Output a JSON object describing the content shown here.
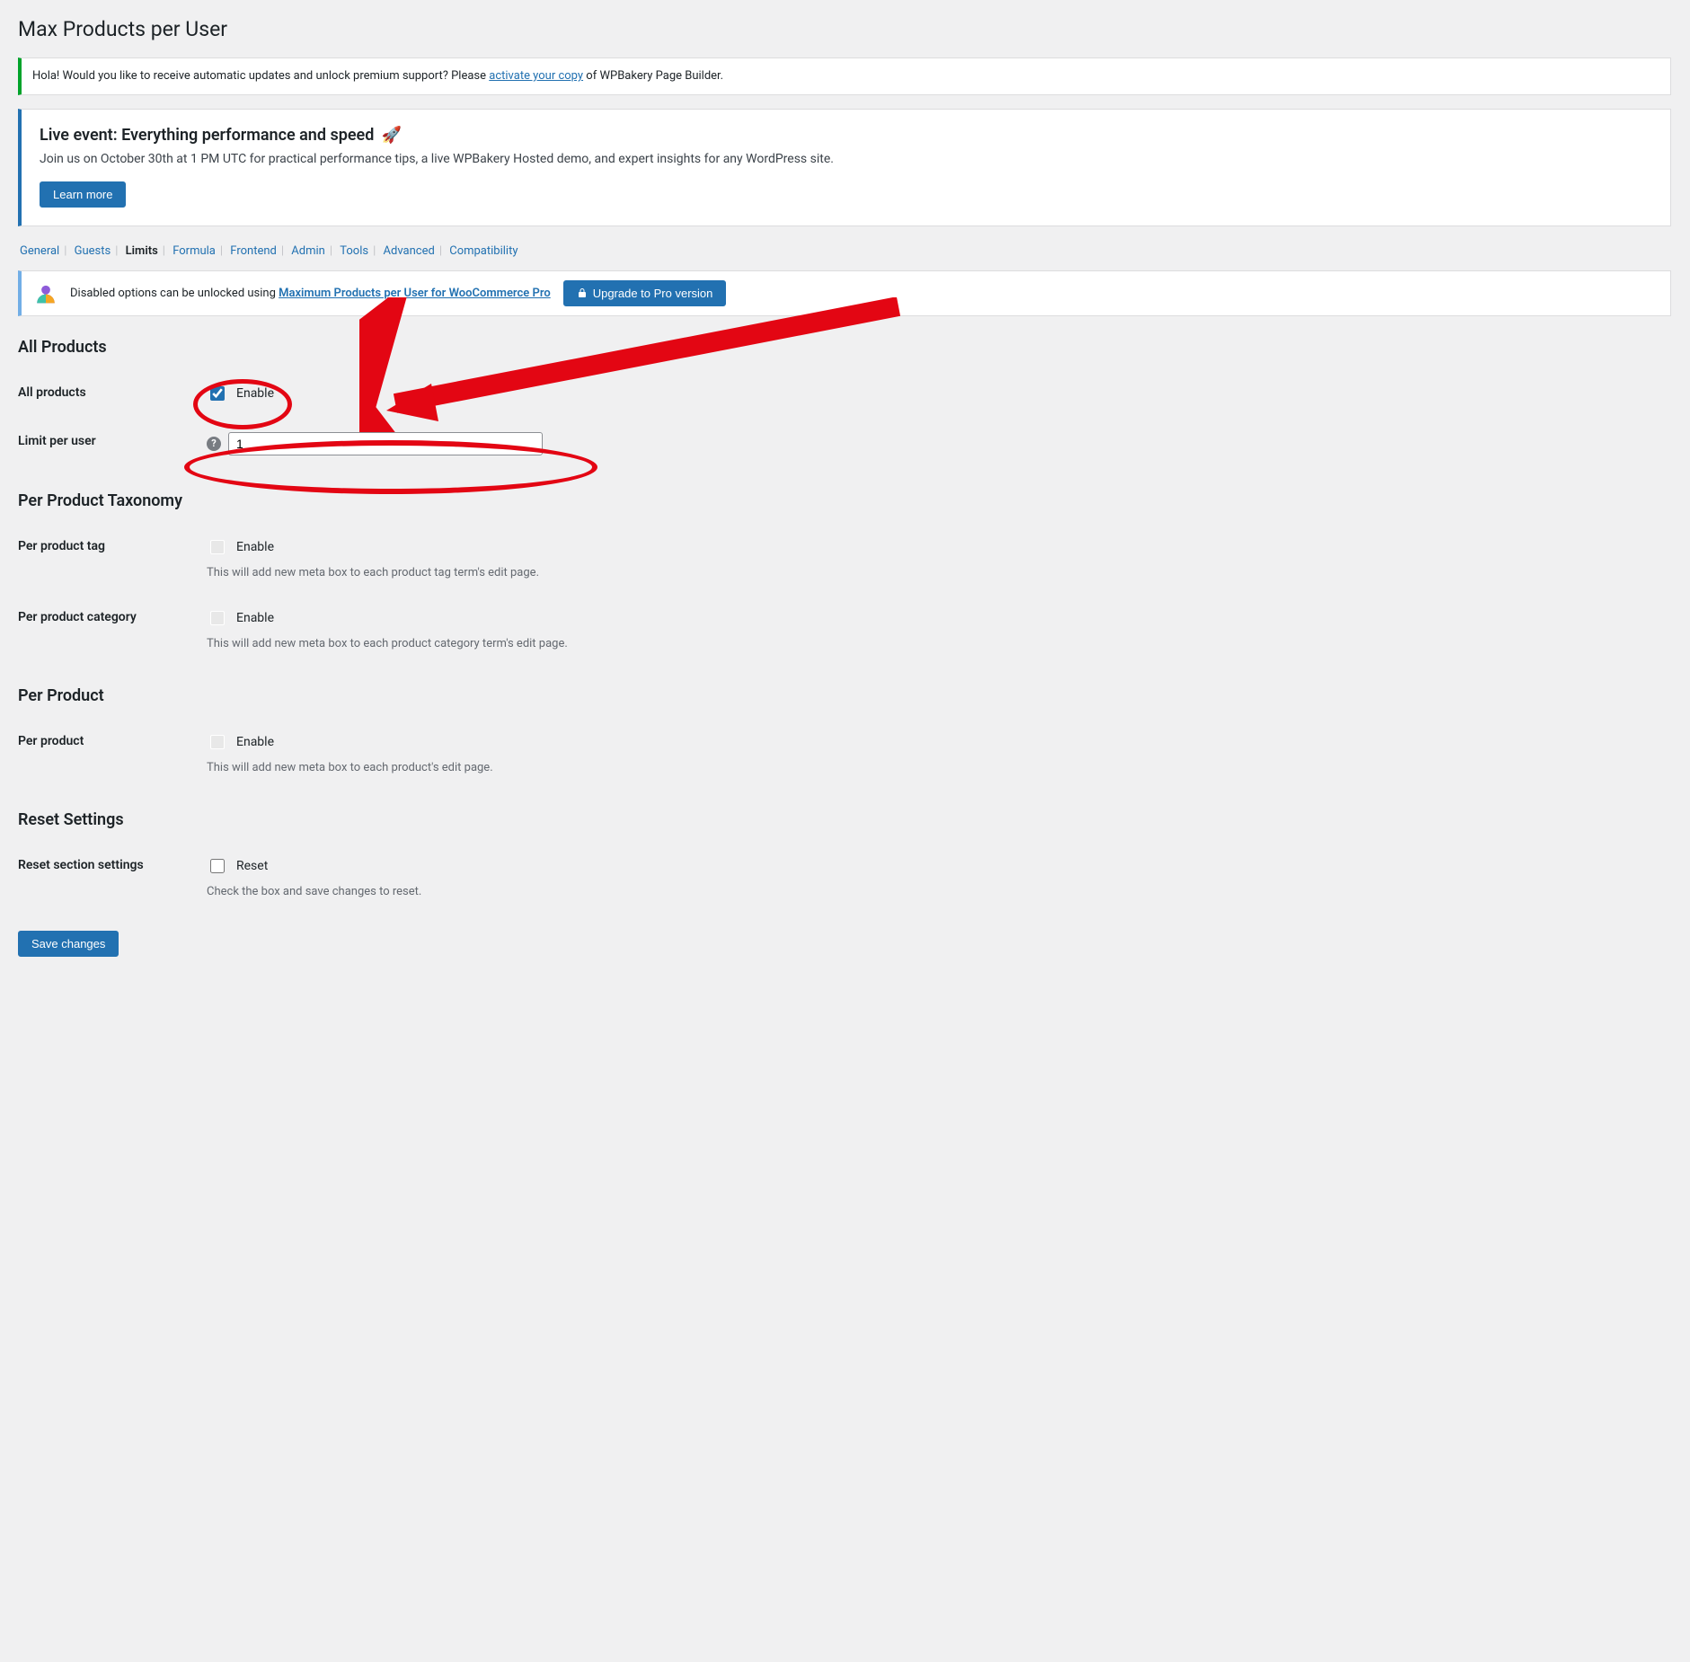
{
  "page": {
    "title": "Max Products per User"
  },
  "notice_activate": {
    "prefix": "Hola! Would you like to receive automatic updates and unlock premium support? Please ",
    "link_text": "activate your copy",
    "suffix": " of WPBakery Page Builder."
  },
  "event": {
    "title": "Live event: Everything performance and speed",
    "rocket": "🚀",
    "body": "Join us on October 30th at 1 PM UTC for practical performance tips, a live WPBakery Hosted demo, and expert insights for any WordPress site.",
    "cta": "Learn more"
  },
  "tabs": {
    "items": [
      {
        "label": "General"
      },
      {
        "label": "Guests"
      },
      {
        "label": "Limits",
        "current": true
      },
      {
        "label": "Formula"
      },
      {
        "label": "Frontend"
      },
      {
        "label": "Admin"
      },
      {
        "label": "Tools"
      },
      {
        "label": "Advanced"
      },
      {
        "label": "Compatibility"
      }
    ]
  },
  "upgrade": {
    "text_prefix": "Disabled options can be unlocked using ",
    "pro_link": "Maximum Products per User for WooCommerce Pro",
    "button": "Upgrade to Pro version"
  },
  "sections": {
    "all_products": {
      "heading": "All Products",
      "row_label": "All products",
      "enable_label": "Enable",
      "limit_label": "Limit per user",
      "limit_value": "1"
    },
    "per_taxonomy": {
      "heading": "Per Product Taxonomy",
      "per_tag_label": "Per product tag",
      "per_tag_enable": "Enable",
      "per_tag_desc": "This will add new meta box to each product tag term's edit page.",
      "per_cat_label": "Per product category",
      "per_cat_enable": "Enable",
      "per_cat_desc": "This will add new meta box to each product category term's edit page."
    },
    "per_product": {
      "heading": "Per Product",
      "row_label": "Per product",
      "enable_label": "Enable",
      "desc": "This will add new meta box to each product's edit page."
    },
    "reset": {
      "heading": "Reset Settings",
      "row_label": "Reset section settings",
      "reset_label": "Reset",
      "desc": "Check the box and save changes to reset."
    }
  },
  "save_button": "Save changes",
  "colors": {
    "annotation_red": "#e30613",
    "primary_blue": "#2271b1"
  }
}
